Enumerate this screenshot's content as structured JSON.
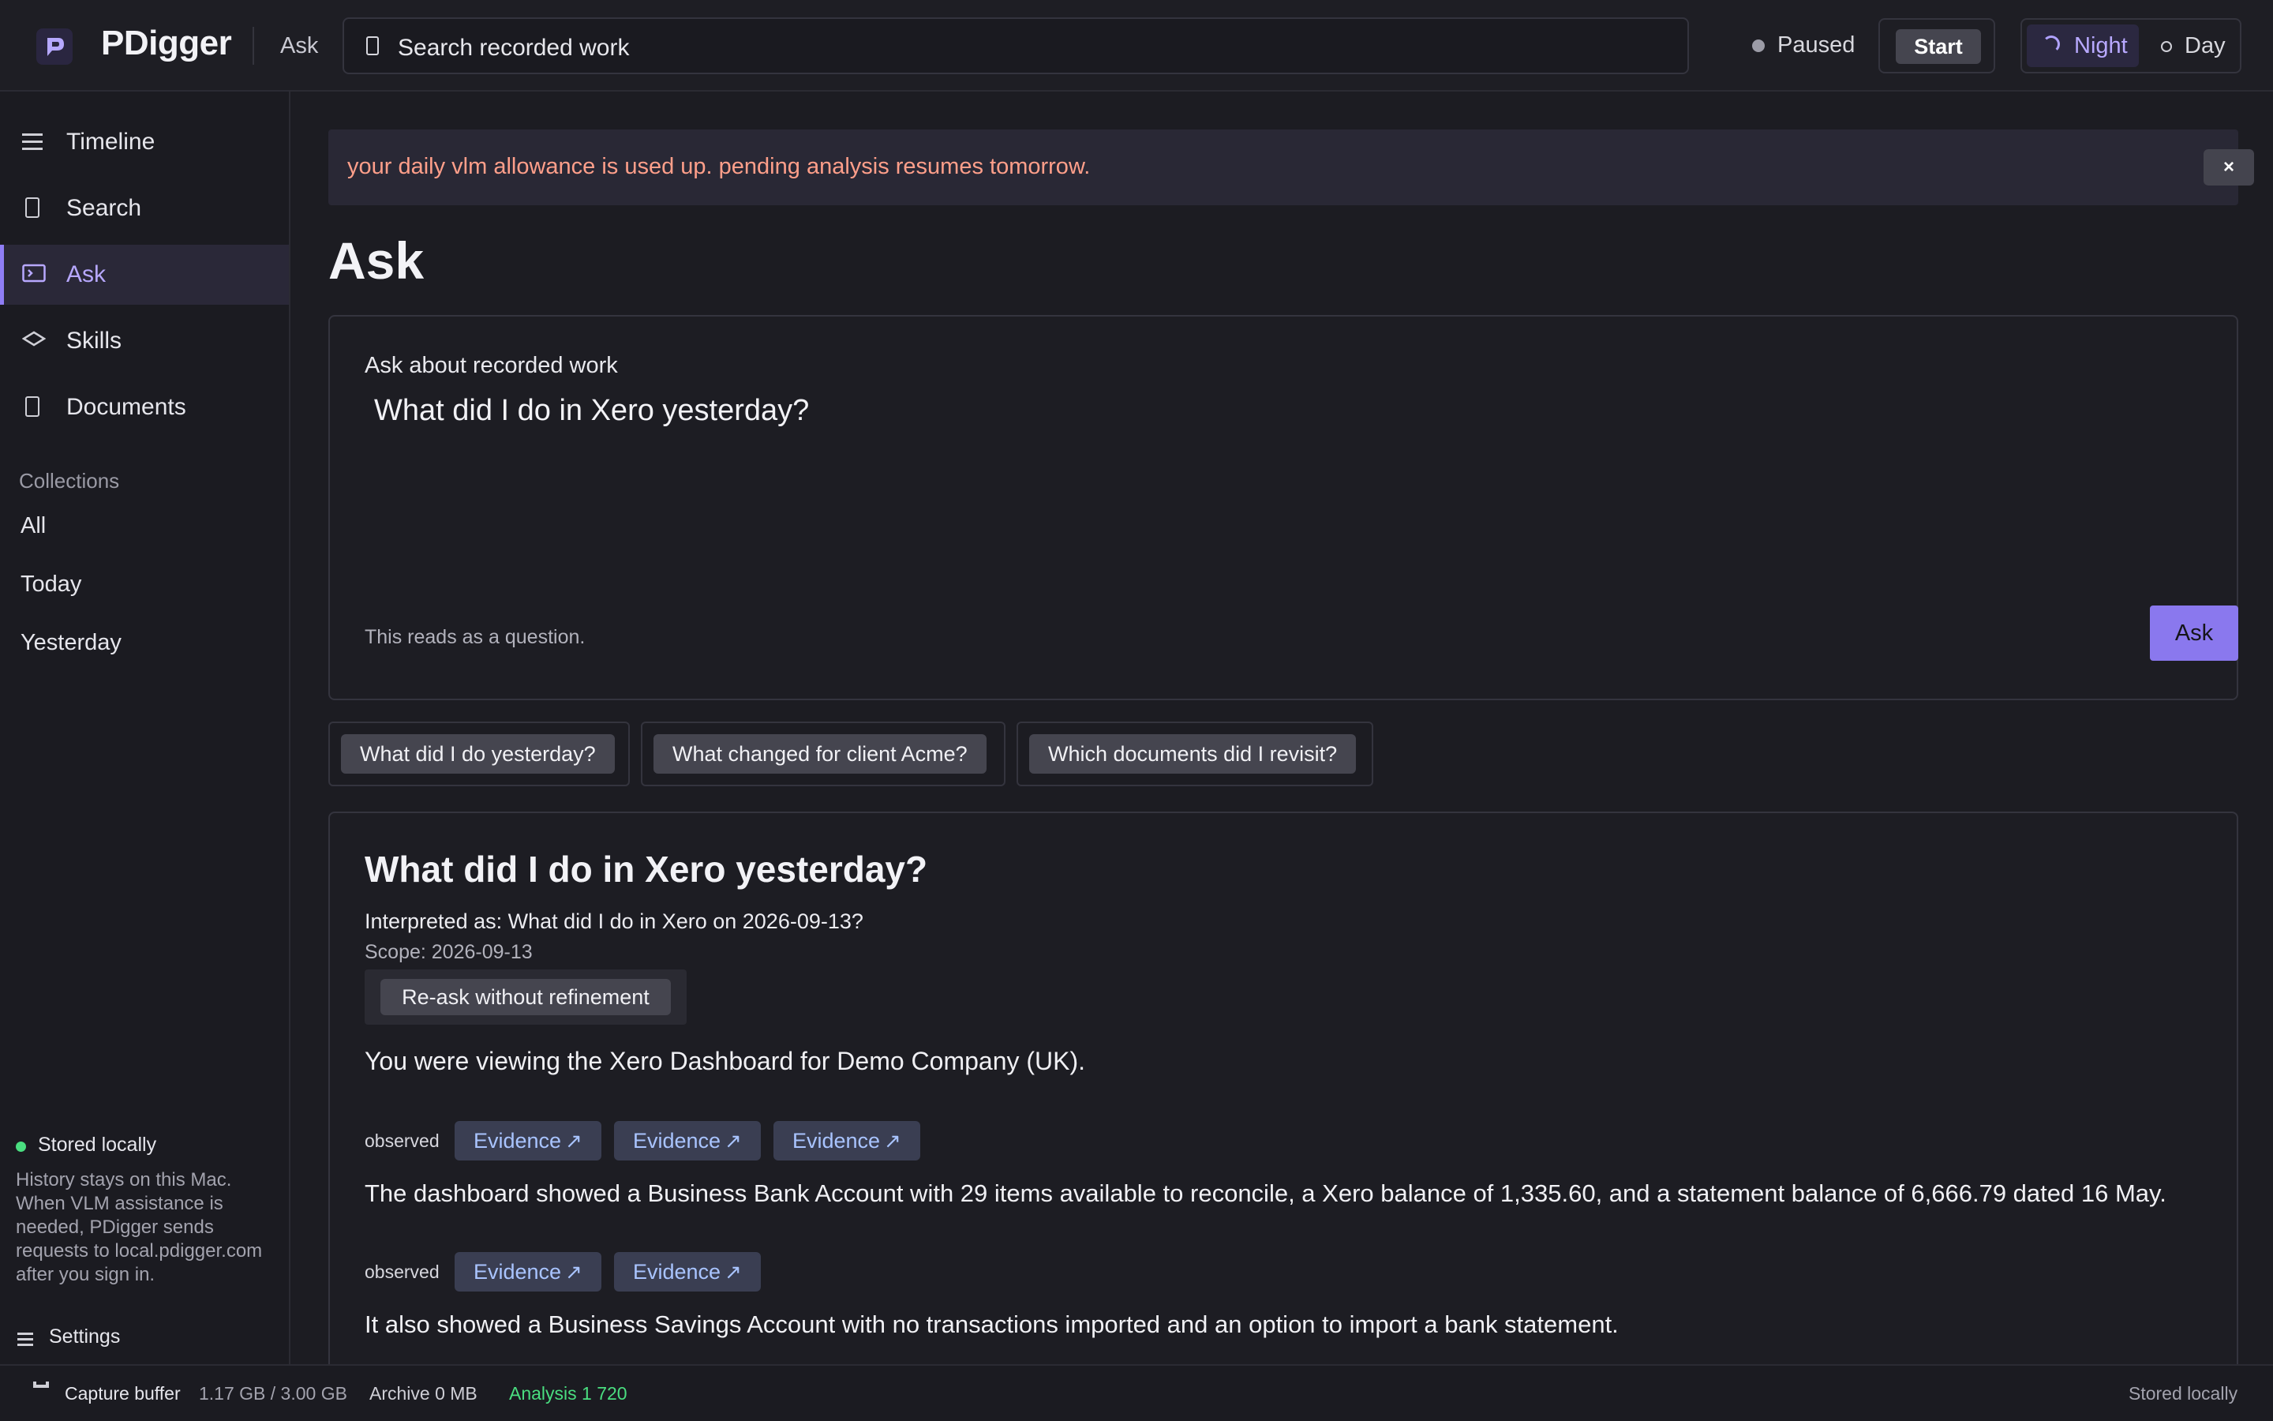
{
  "app": {
    "name": "PDigger",
    "crumb": "Ask"
  },
  "search": {
    "placeholder": "Search recorded work",
    "icon": "doc-icon"
  },
  "capture": {
    "status": "Paused",
    "start_label": "Start"
  },
  "theme": {
    "options": [
      "Night",
      "Day"
    ],
    "selected": "Night"
  },
  "colors": {
    "accent": "#8a78ee",
    "warning_text": "#ff9f8a",
    "ok": "#4ade80",
    "evidence_chip": "#3a3e52"
  },
  "sidebar": {
    "items": [
      {
        "label": "Timeline",
        "icon": "list-icon"
      },
      {
        "label": "Search",
        "icon": "doc-icon"
      },
      {
        "label": "Ask",
        "icon": "terminal-icon",
        "active": true
      },
      {
        "label": "Skills",
        "icon": "layers-icon"
      },
      {
        "label": "Documents",
        "icon": "doc-icon"
      }
    ],
    "collections_label": "Collections",
    "collections": [
      "All",
      "Today",
      "Yesterday"
    ],
    "stored_title": "Stored locally",
    "stored_desc": "History stays on this Mac. When VLM assistance is needed, PDigger sends requests to local.pdigger.com after you sign in.",
    "settings_label": "Settings"
  },
  "banner": {
    "message": "your daily vlm allowance is used up. pending analysis resumes tomorrow.",
    "close_label": "×"
  },
  "page": {
    "title": "Ask"
  },
  "ask": {
    "label": "Ask about recorded work",
    "value": "What did I do in Xero yesterday?",
    "hint": "This reads as a question.",
    "button": "Ask"
  },
  "suggestions": [
    "What did I do yesterday?",
    "What changed for client Acme?",
    "Which documents did I revisit?"
  ],
  "answer": {
    "title": "What did I do in Xero yesterday?",
    "interpreted": "Interpreted as: What did I do in Xero on 2026-09-13?",
    "scope": "Scope: 2026-09-13",
    "reask_label": "Re-ask without refinement",
    "summary": "You were viewing the Xero Dashboard for Demo Company (UK).",
    "observed_label": "observed",
    "evidence_label": "Evidence",
    "evidence_arrow": "↗",
    "sentences": [
      "The dashboard showed a Business Bank Account with 29 items available to reconcile, a Xero balance of 1,335.60, and a statement balance of 6,666.79 dated 16 May.",
      "It also showed a Business Savings Account with no transactions imported and an option to import a bank statement."
    ]
  },
  "statusbar": {
    "capture_label": "Capture buffer",
    "capture_value": "1.17 GB / 3.00 GB",
    "archive": "Archive 0 MB",
    "analysis": "Analysis 1 720",
    "stored": "Stored locally"
  }
}
